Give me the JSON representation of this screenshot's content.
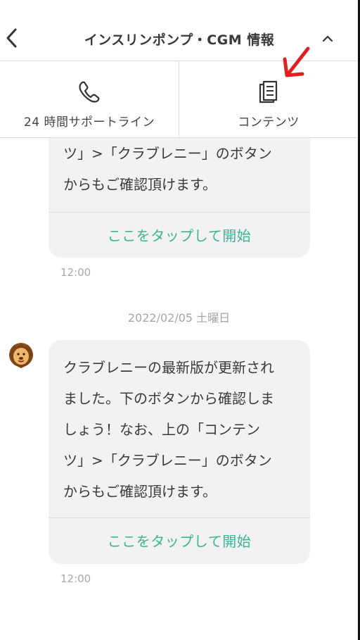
{
  "header": {
    "title": "インスリンポンプ・CGM 情報",
    "back_icon": "chevron-left-icon",
    "collapse_icon": "chevron-up-icon"
  },
  "tabs": [
    {
      "label": "24 時間サポートライン",
      "icon": "phone-icon"
    },
    {
      "label": "コンテンツ",
      "icon": "document-list-icon"
    }
  ],
  "annotation": {
    "icon": "arrow-icon",
    "color": "#e02020"
  },
  "chat": {
    "message_top": {
      "lines": [
        "ツ」>「クラブレニー」のボタン",
        "からもご確認頂けます。"
      ],
      "action": "ここをタップして開始",
      "time": "12:00"
    },
    "date_separator": "2022/02/05 土曜日",
    "message_bottom": {
      "lines": [
        "クラブレニーの最新版が更新され",
        "ました。下のボタンから確認しま",
        "しょう！なお、上の「コンテン",
        "ツ」>「クラブレニー」のボタン",
        "からもご確認頂けます。"
      ],
      "action": "ここをタップして開始",
      "time": "12:00",
      "avatar": "lion-avatar-icon"
    }
  },
  "colors": {
    "accent": "#3db394",
    "bubble_bg": "#f2f2f2",
    "timestamp": "#aaaaaa"
  }
}
